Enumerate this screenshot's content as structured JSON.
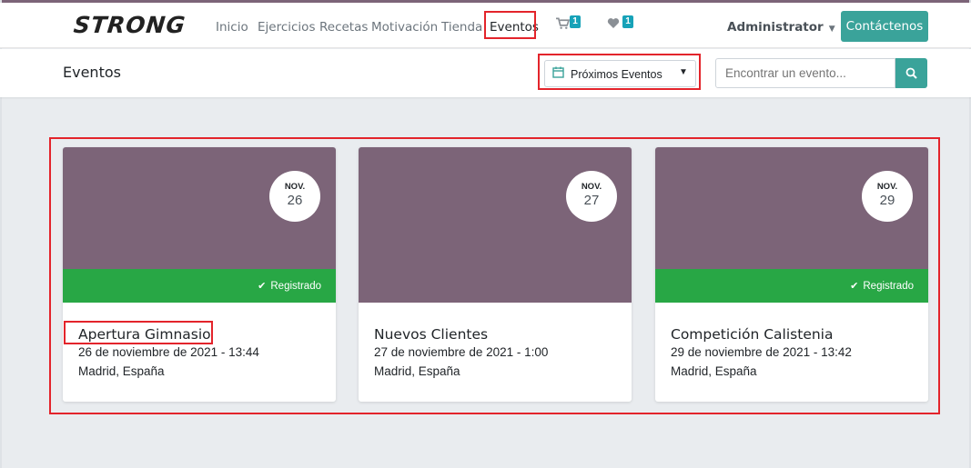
{
  "brand": {
    "logo": "STRONG",
    "accent": "#3aa39a",
    "primary": "#7c6478",
    "success": "#28a745"
  },
  "nav": {
    "items": [
      {
        "label": "Inicio"
      },
      {
        "label": "Ejercicios"
      },
      {
        "label": "Recetas"
      },
      {
        "label": "Motivación"
      },
      {
        "label": "Tienda"
      },
      {
        "label": "Eventos"
      }
    ],
    "cart_icon": "cart-icon",
    "cart_count": "1",
    "wishlist_icon": "heart-icon",
    "wishlist_count": "1",
    "user": "Administrator",
    "contact": "Contáctenos"
  },
  "subheader": {
    "title": "Eventos",
    "filter": "Próximos Eventos",
    "search_placeholder": "Encontrar un evento..."
  },
  "events": [
    {
      "month": "NOV.",
      "day": "26",
      "status": "Registrado",
      "title": "Apertura Gimnasio",
      "date": "26 de noviembre de 2021 - 13:44",
      "location": "Madrid, España"
    },
    {
      "month": "NOV.",
      "day": "27",
      "status": "",
      "title": "Nuevos Clientes",
      "date": "27 de noviembre de 2021 - 1:00",
      "location": "Madrid, España"
    },
    {
      "month": "NOV.",
      "day": "29",
      "status": "Registrado",
      "title": "Competición Calistenia",
      "date": "29 de noviembre de 2021 - 13:42",
      "location": "Madrid, España"
    }
  ]
}
